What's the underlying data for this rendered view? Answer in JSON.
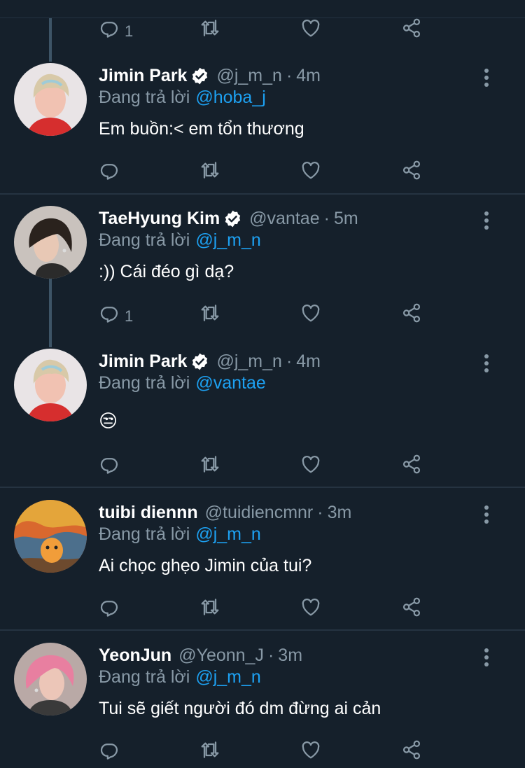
{
  "colors": {
    "background": "#15202b",
    "secondary_text": "#8899a6",
    "mention": "#1da1f2",
    "divider": "#253341"
  },
  "top_actions": {
    "reply_count": "1"
  },
  "replying_label": "Đang trả lời",
  "tweets": [
    {
      "name": "Jimin Park",
      "verified": true,
      "handle": "@j_m_n",
      "separator": "·",
      "time": "4m",
      "replying_to": "@hoba_j",
      "text": "Em buồn:< em tổn thương",
      "reply_count": "",
      "avatar_icon": "avatar-photo"
    },
    {
      "name": "TaeHyung Kim",
      "verified": true,
      "handle": "@vantae",
      "separator": "·",
      "time": "5m",
      "replying_to": "@j_m_n",
      "text": ":)) Cái đéo gì dạ?",
      "reply_count": "1",
      "avatar_icon": "avatar-photo"
    },
    {
      "name": "Jimin Park",
      "verified": true,
      "handle": "@j_m_n",
      "separator": "·",
      "time": "4m",
      "replying_to": "@vantae",
      "text": "😒",
      "reply_count": "",
      "avatar_icon": "avatar-photo"
    },
    {
      "name": "tuibi diennn",
      "verified": false,
      "handle": "@tuidiencmnr",
      "separator": "·",
      "time": "3m",
      "replying_to": "@j_m_n",
      "text": "Ai chọc ghẹo Jimin của tui?",
      "reply_count": "",
      "avatar_icon": "avatar-photo"
    },
    {
      "name": "YeonJun",
      "verified": false,
      "handle": "@Yeonn_J",
      "separator": "·",
      "time": "3m",
      "replying_to": "@j_m_n",
      "text": "Tui sẽ giết người đó dm đừng ai cản",
      "reply_count": "",
      "avatar_icon": "avatar-photo"
    }
  ],
  "icons": {
    "reply": "reply-icon",
    "retweet": "retweet-icon",
    "like": "heart-icon",
    "share": "share-icon",
    "more": "more-options-icon",
    "verified": "verified-badge-icon"
  }
}
